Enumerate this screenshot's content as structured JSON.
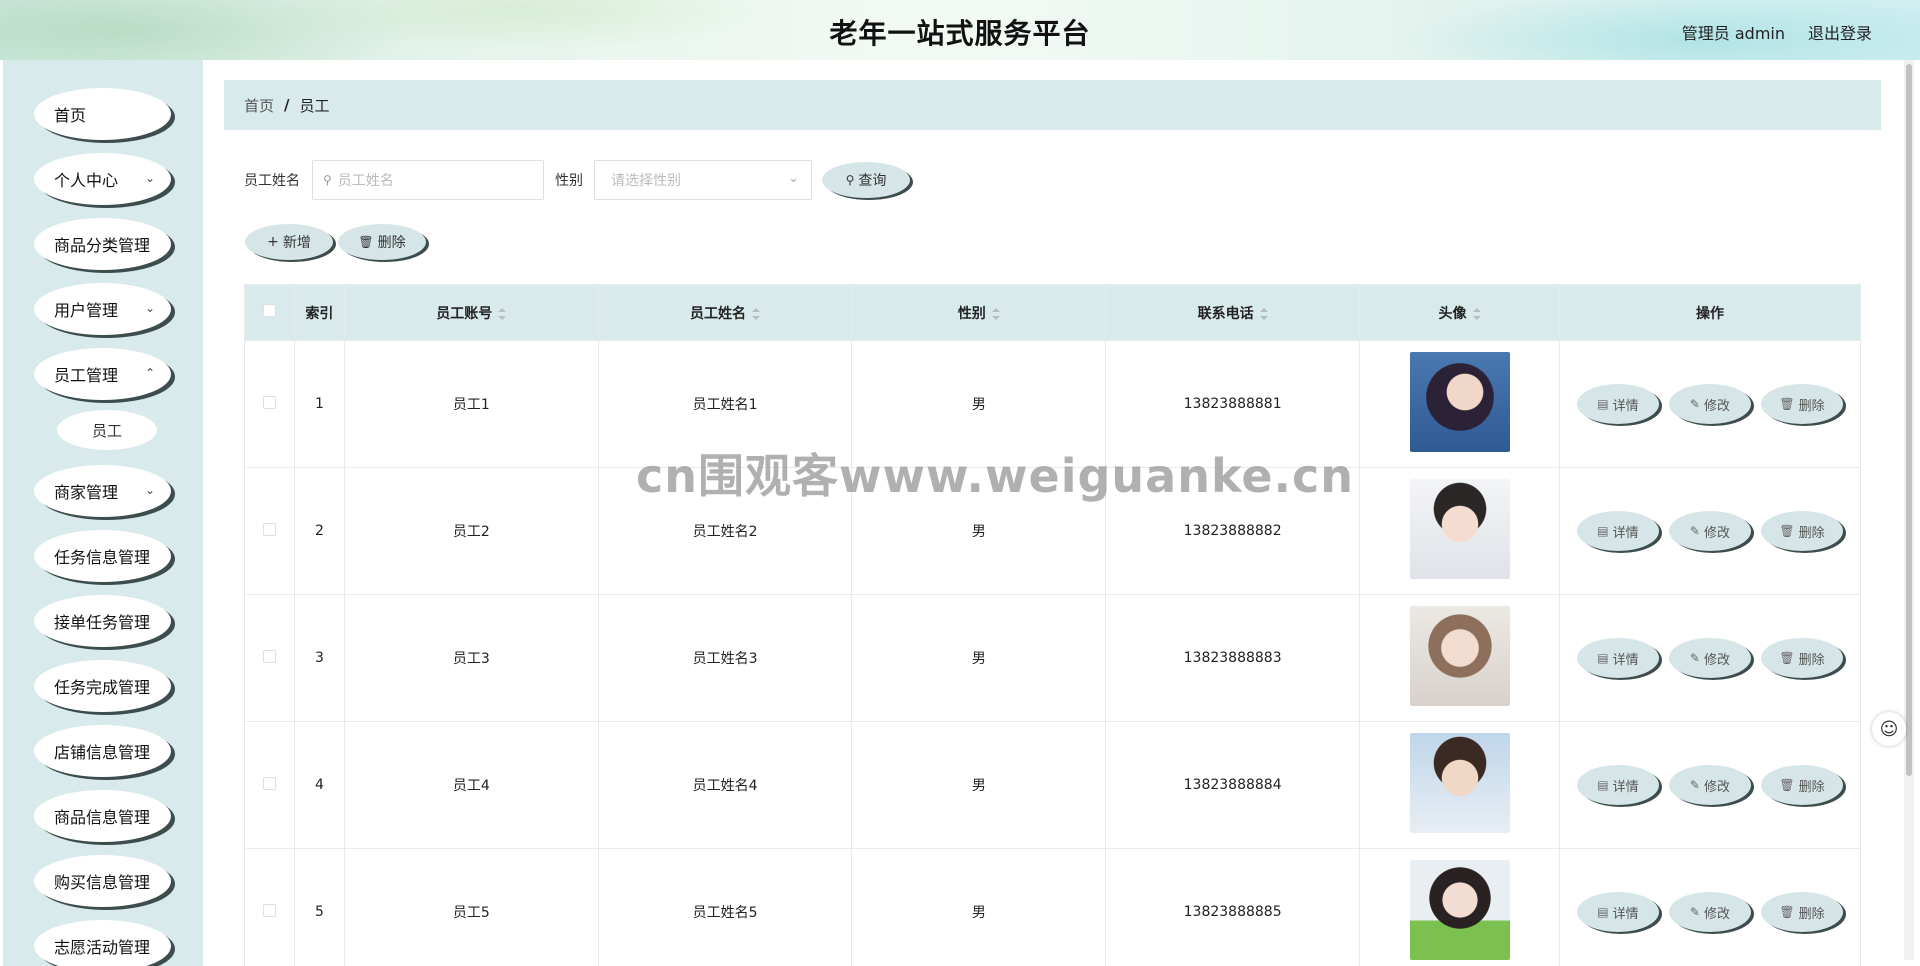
{
  "header": {
    "title": "老年一站式服务平台",
    "user_label": "管理员 admin",
    "logout_label": "退出登录"
  },
  "sidebar": {
    "items": [
      {
        "label": "首页",
        "has_children": false
      },
      {
        "label": "个人中心",
        "has_children": true
      },
      {
        "label": "商品分类管理",
        "has_children": false
      },
      {
        "label": "用户管理",
        "has_children": true
      },
      {
        "label": "员工管理",
        "has_children": true
      },
      {
        "label": "商家管理",
        "has_children": true
      },
      {
        "label": "任务信息管理",
        "has_children": false
      },
      {
        "label": "接单任务管理",
        "has_children": false
      },
      {
        "label": "任务完成管理",
        "has_children": false
      },
      {
        "label": "店铺信息管理",
        "has_children": false
      },
      {
        "label": "商品信息管理",
        "has_children": false
      },
      {
        "label": "购买信息管理",
        "has_children": false
      },
      {
        "label": "志愿活动管理",
        "has_children": false
      }
    ],
    "sub_item": "员工"
  },
  "breadcrumb": {
    "home": "首页",
    "separator": "/",
    "current": "员工"
  },
  "search": {
    "name_label": "员工姓名",
    "name_placeholder": "员工姓名",
    "gender_label": "性别",
    "gender_placeholder": "请选择性别",
    "query_label": "查询"
  },
  "toolbar": {
    "add_label": "新增",
    "delete_label": "删除"
  },
  "table": {
    "columns": [
      "索引",
      "员工账号",
      "员工姓名",
      "性别",
      "联系电话",
      "头像",
      "操作"
    ],
    "rows": [
      {
        "index": "1",
        "account": "员工1",
        "name": "员工姓名1",
        "gender": "男",
        "phone": "13823888881"
      },
      {
        "index": "2",
        "account": "员工2",
        "name": "员工姓名2",
        "gender": "男",
        "phone": "13823888882"
      },
      {
        "index": "3",
        "account": "员工3",
        "name": "员工姓名3",
        "gender": "男",
        "phone": "13823888883"
      },
      {
        "index": "4",
        "account": "员工4",
        "name": "员工姓名4",
        "gender": "男",
        "phone": "13823888884"
      },
      {
        "index": "5",
        "account": "员工5",
        "name": "员工姓名5",
        "gender": "男",
        "phone": "13823888885"
      }
    ],
    "row_actions": {
      "detail": "详情",
      "edit": "修改",
      "delete": "删除"
    }
  },
  "watermark": "cn围观客www.weiguanke.cn",
  "colors": {
    "sidebar_bg": "#d9eaec",
    "button_bg": "#d6e6e8",
    "button_shadow": "#3d4d4e",
    "table_header_bg": "#d9eaec"
  }
}
